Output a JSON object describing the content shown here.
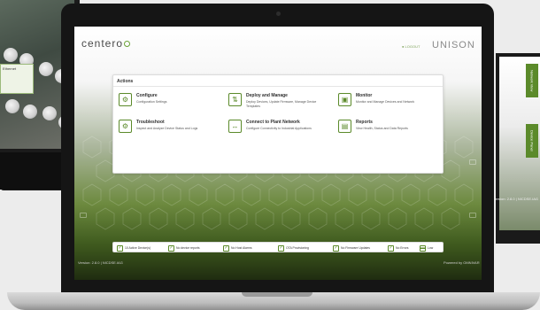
{
  "app": {
    "logo_text": "centero",
    "logout_label": "LOGOUT",
    "product_name": "UNISON"
  },
  "actions_panel": {
    "title": "Actions",
    "items": [
      {
        "title": "Configure",
        "desc": "Configuration Settings",
        "icon": "gear-icon"
      },
      {
        "title": "Deploy and Manage",
        "desc": "Deploy Devices, Update Firmware, Manage Device Templates",
        "icon": "deploy-icon"
      },
      {
        "title": "Monitor",
        "desc": "Monitor and Manage Devices and Network",
        "icon": "monitor-icon"
      },
      {
        "title": "Troubleshoot",
        "desc": "Inspect and Analyze Device Status and Logs",
        "icon": "gears-icon"
      },
      {
        "title": "Connect to Plant Network",
        "desc": "Configure Connectivity to Industrial Applications",
        "icon": "connect-icon"
      },
      {
        "title": "Reports",
        "desc": "View Health, Status and Data Reports",
        "icon": "document-icon"
      }
    ]
  },
  "status_bar": {
    "items": [
      "10 Active Device(s)",
      "No device reports",
      "No Host Alarms",
      "OTA Provisioning",
      "No Firmware Updates",
      "No Errors",
      "Low"
    ]
  },
  "footer": {
    "version": "Version: 2.8.0 | NICDSE.IAG",
    "powered_by": "Powered by OMNIVAR"
  },
  "left_monitor": {
    "popup_title": "Ethernet"
  },
  "right_monitor": {
    "tabs": [
      "Network View",
      "Device Panel"
    ],
    "version": "Version: 2.8.0 | NICDSE.IAG"
  },
  "colors": {
    "accent": "#5b8a2a",
    "header_bg": "#ffffff",
    "panel_bg": "#ffffff",
    "bezel": "#151515"
  }
}
